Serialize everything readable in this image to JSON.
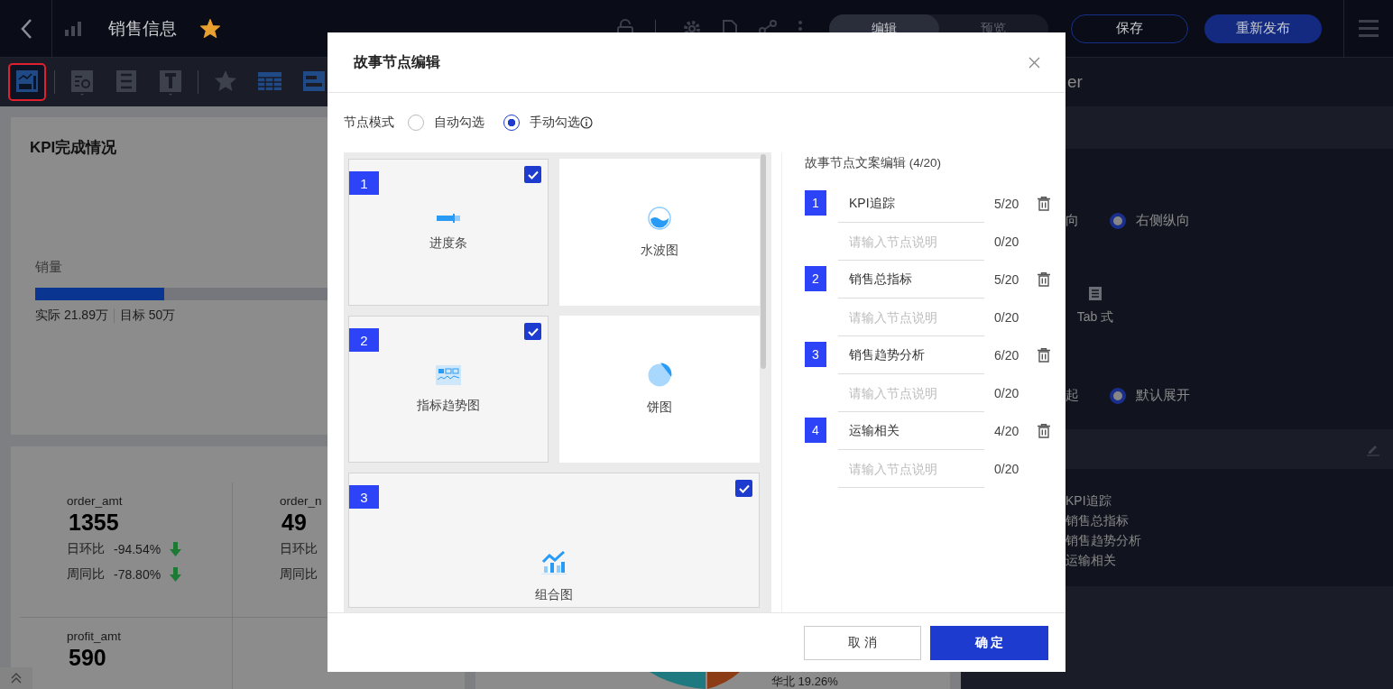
{
  "header": {
    "title": "销售信息",
    "starred": true,
    "mode_tabs": [
      {
        "label": "编辑",
        "selected": true
      },
      {
        "label": "预览",
        "selected": false
      }
    ],
    "save_button": "保存",
    "publish_button": "重新发布"
  },
  "toolbar": {
    "groups": [
      [
        {
          "kind": "story",
          "selected": true
        }
      ],
      [
        {
          "kind": "query",
          "selected": false
        },
        {
          "kind": "form",
          "selected": false
        },
        {
          "kind": "text",
          "selected": false
        }
      ],
      [
        {
          "kind": "favorite",
          "selected": false
        },
        {
          "kind": "table",
          "selected": false
        },
        {
          "kind": "panel",
          "selected": false
        }
      ]
    ]
  },
  "canvas": {
    "kpi_card": {
      "title": "KPI完成情况",
      "metric": {
        "label": "销量",
        "level": 0.44,
        "actual": "实际 21.89万",
        "target": "目标 50万"
      }
    },
    "metrics": [
      {
        "name": "order_amt",
        "value": "1355",
        "comparisons": [
          {
            "label": "日环比",
            "value": "-94.54%",
            "kind": "down"
          },
          {
            "label": "周同比",
            "value": "-78.80%",
            "kind": "down"
          }
        ]
      },
      {
        "name": "order_n",
        "value": "49",
        "comparisons": [
          {
            "label": "日环比"
          },
          {
            "label": "周同比"
          }
        ]
      },
      {
        "name": "profit_amt",
        "value": "590"
      }
    ],
    "pie_label": "华北 19.26%"
  },
  "right_panel": {
    "title": "er",
    "layout": {
      "cut_label": "向",
      "option": {
        "label": "右侧纵向",
        "selected": true
      }
    },
    "style_label": "Tab 式",
    "expand": {
      "cut_label": "起",
      "option": {
        "label": "默认展开",
        "selected": true
      }
    },
    "nodes": [
      "KPI追踪",
      "销售总指标",
      "销售趋势分析",
      "运输相关"
    ]
  },
  "modal": {
    "title": "故事节点编辑",
    "mode": {
      "label": "节点模式",
      "options": [
        {
          "label": "自动勾选",
          "selected": false
        },
        {
          "label": "手动勾选",
          "selected": true
        }
      ]
    },
    "charts": [
      {
        "number": "1",
        "kind": "progress",
        "label": "进度条",
        "checked": true,
        "wide": false
      },
      {
        "kind": "liquid",
        "label": "水波图",
        "checked": false,
        "wide": false
      },
      {
        "number": "2",
        "kind": "trend",
        "label": "指标趋势图",
        "checked": true,
        "wide": false
      },
      {
        "kind": "pie",
        "label": "饼图",
        "checked": false,
        "wide": false
      },
      {
        "number": "3",
        "kind": "combo",
        "label": "组合图",
        "checked": true,
        "wide": true
      }
    ],
    "editor": {
      "title": "故事节点文案编辑 (4/20)",
      "nodes": [
        {
          "number": "1",
          "title": "KPI追踪",
          "title_count": "5/20",
          "description_placeholder": "请输入节点说明",
          "description_count": "0/20"
        },
        {
          "number": "2",
          "title": "销售总指标",
          "title_count": "5/20",
          "description_placeholder": "请输入节点说明",
          "description_count": "0/20"
        },
        {
          "number": "3",
          "title": "销售趋势分析",
          "title_count": "6/20",
          "description_placeholder": "请输入节点说明",
          "description_count": "0/20"
        },
        {
          "number": "4",
          "title": "运输相关",
          "title_count": "4/20",
          "description_placeholder": "请输入节点说明",
          "description_count": "0/20"
        }
      ]
    },
    "cancel_button": "取 消",
    "confirm_button": "确 定"
  }
}
